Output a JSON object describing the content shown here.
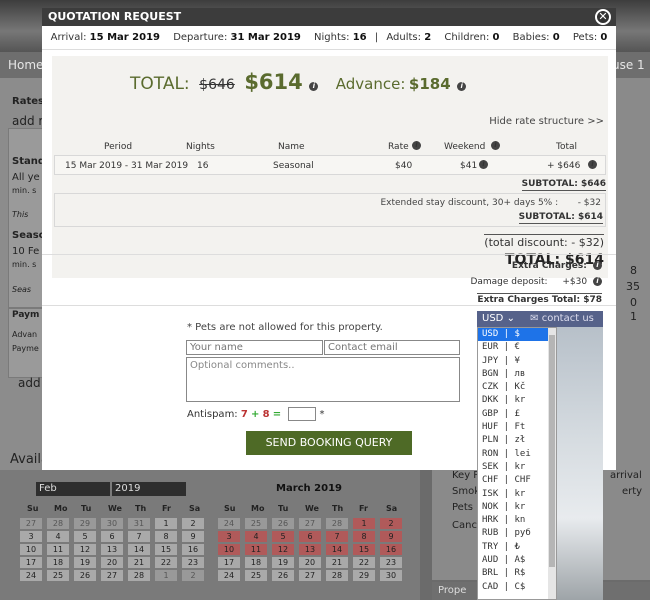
{
  "modal": {
    "title": "QUOTATION REQUEST",
    "close_glyph": "✕",
    "info": {
      "arrival_label": "Arrival:",
      "arrival": "15 Mar 2019",
      "departure_label": "Departure:",
      "departure": "31 Mar 2019",
      "nights_label": "Nights:",
      "nights": "16",
      "adults_label": "Adults:",
      "adults": "2",
      "children_label": "Children:",
      "children": "0",
      "babies_label": "Babies:",
      "babies": "0",
      "pets_label": "Pets:",
      "pets": "0"
    },
    "total": {
      "label": "TOTAL:",
      "old": "$646",
      "new": "$614",
      "advance_label": "Advance:",
      "advance": "$184"
    },
    "hide_rate": "Hide rate structure >>",
    "table": {
      "headers": {
        "period": "Period",
        "nights": "Nights",
        "name": "Name",
        "rate": "Rate",
        "weekend": "Weekend",
        "total": "Total"
      },
      "row": {
        "period": "15 Mar 2019 - 31 Mar 2019",
        "nights": "16",
        "name": "Seasonal",
        "rate": "$40",
        "weekend": "$41",
        "total": "+ $646"
      }
    },
    "subtotal1": "SUBTOTAL: $646",
    "discount": {
      "label": "Extended stay discount, 30+ days 5% :",
      "amount": "- $32",
      "subtotal": "SUBTOTAL: $614"
    },
    "total_discount": "(total discount: - $32)",
    "final_total": "TOTAL:  $614",
    "extra": {
      "title": "Extra Charges:",
      "damage_label": "Damage deposit:",
      "damage": "+$30",
      "total": "Extra Charges Total: $78"
    },
    "form": {
      "note": "* Pets are not allowed for this property.",
      "name_placeholder": "Your name",
      "email_placeholder": "Contact email",
      "comments_placeholder": "Optional comments..",
      "antispam_label": "Antispam:",
      "antispam_a": "7",
      "antispam_op": "+",
      "antispam_b": "8",
      "antispam_eq": "=",
      "antispam_star": "*",
      "send": "SEND BOOKING QUERY"
    }
  },
  "currency": {
    "selected": "USD",
    "contact": "contact us",
    "items": [
      "USD | $",
      "EUR | €",
      "JPY | ¥",
      "BGN | лв",
      "CZK | Kč",
      "DKK | kr",
      "GBP | £",
      "HUF | Ft",
      "PLN | zł",
      "RON | lei",
      "SEK | kr",
      "CHF | CHF",
      "ISK | kr",
      "NOK | kr",
      "HRK | kn",
      "RUB | руб",
      "TRY | ₺",
      "AUD | A$",
      "BRL | R$",
      "CAD | C$"
    ]
  },
  "background": {
    "nav_home": "Homep",
    "nav_right": "use 1",
    "left_labels": [
      "Rates",
      "add r",
      "Stand",
      "All ye",
      "min. s",
      "This",
      "Seaso",
      "10 Fe",
      "min. s",
      "Seas",
      "Paym",
      "Advan",
      "Payme",
      "add r"
    ],
    "right_values": [
      "8",
      "35",
      "0",
      "1"
    ],
    "avail": "Availa",
    "cal_month_select": "Feb",
    "cal_year_select": "2019",
    "cal_title": "March 2019",
    "cal_days": [
      "Su",
      "Mo",
      "Tu",
      "We",
      "Th",
      "Fr",
      "Sa"
    ],
    "feb_rows": [
      [
        "27",
        "28",
        "29",
        "30",
        "31",
        "1",
        "2"
      ],
      [
        "3",
        "4",
        "5",
        "6",
        "7",
        "8",
        "9"
      ],
      [
        "10",
        "11",
        "12",
        "13",
        "14",
        "15",
        "16"
      ],
      [
        "17",
        "18",
        "19",
        "20",
        "21",
        "22",
        "23"
      ],
      [
        "24",
        "25",
        "26",
        "27",
        "28",
        "1",
        "2"
      ]
    ],
    "mar_rows": [
      [
        "24",
        "25",
        "26",
        "27",
        "28",
        "1",
        "2"
      ],
      [
        "3",
        "4",
        "5",
        "6",
        "7",
        "8",
        "9"
      ],
      [
        "10",
        "11",
        "12",
        "13",
        "14",
        "15",
        "16"
      ],
      [
        "17",
        "18",
        "19",
        "20",
        "21",
        "22",
        "23"
      ],
      [
        "24",
        "25",
        "26",
        "27",
        "28",
        "29",
        "30"
      ]
    ],
    "rbox": [
      "Key P",
      "Smok",
      "Pets :",
      "Cance"
    ],
    "rbox_right": [
      "arrival",
      "erty"
    ],
    "prop": "Prope"
  }
}
